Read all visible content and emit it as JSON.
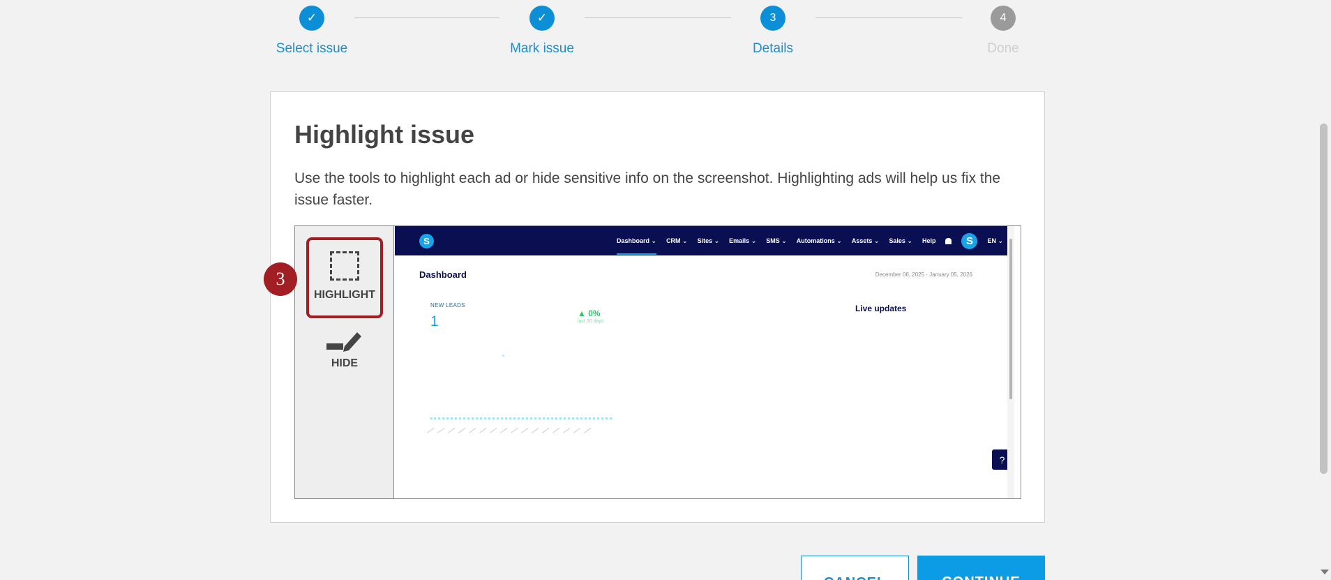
{
  "stepper": {
    "steps": [
      {
        "marker": "✓",
        "label": "Select issue",
        "state": "complete"
      },
      {
        "marker": "✓",
        "label": "Mark issue",
        "state": "complete"
      },
      {
        "marker": "3",
        "label": "Details",
        "state": "current"
      },
      {
        "marker": "4",
        "label": "Done",
        "state": "upcoming"
      }
    ]
  },
  "card": {
    "title": "Highlight issue",
    "description": "Use the tools to highlight each ad or hide sensitive info on the screenshot. Highlighting ads will help us fix the issue faster."
  },
  "tools": {
    "highlight_label": "HIGHLIGHT",
    "hide_label": "HIDE",
    "annotation_badge": "3"
  },
  "preview": {
    "logo_letter": "S",
    "nav": [
      "Dashboard ⌄",
      "CRM ⌄",
      "Sites ⌄",
      "Emails ⌄",
      "SMS ⌄",
      "Automations ⌄",
      "Assets ⌄",
      "Sales ⌄",
      "Help"
    ],
    "avatar_letter": "S",
    "lang": "EN ⌄",
    "title": "Dashboard",
    "date_range": "December 06, 2025 - January 05, 2026",
    "leads_label": "NEW LEADS",
    "leads_value": "1",
    "change": "▲ 0%",
    "change_sub": "last 30 days",
    "live_updates": "Live updates",
    "help": "?"
  },
  "buttons": {
    "cancel": "CANCEL",
    "continue": "CONTINUE"
  },
  "colors": {
    "accent": "#0c8fd6",
    "annotation": "#a11f24",
    "mini_nav": "#0a0f52"
  }
}
